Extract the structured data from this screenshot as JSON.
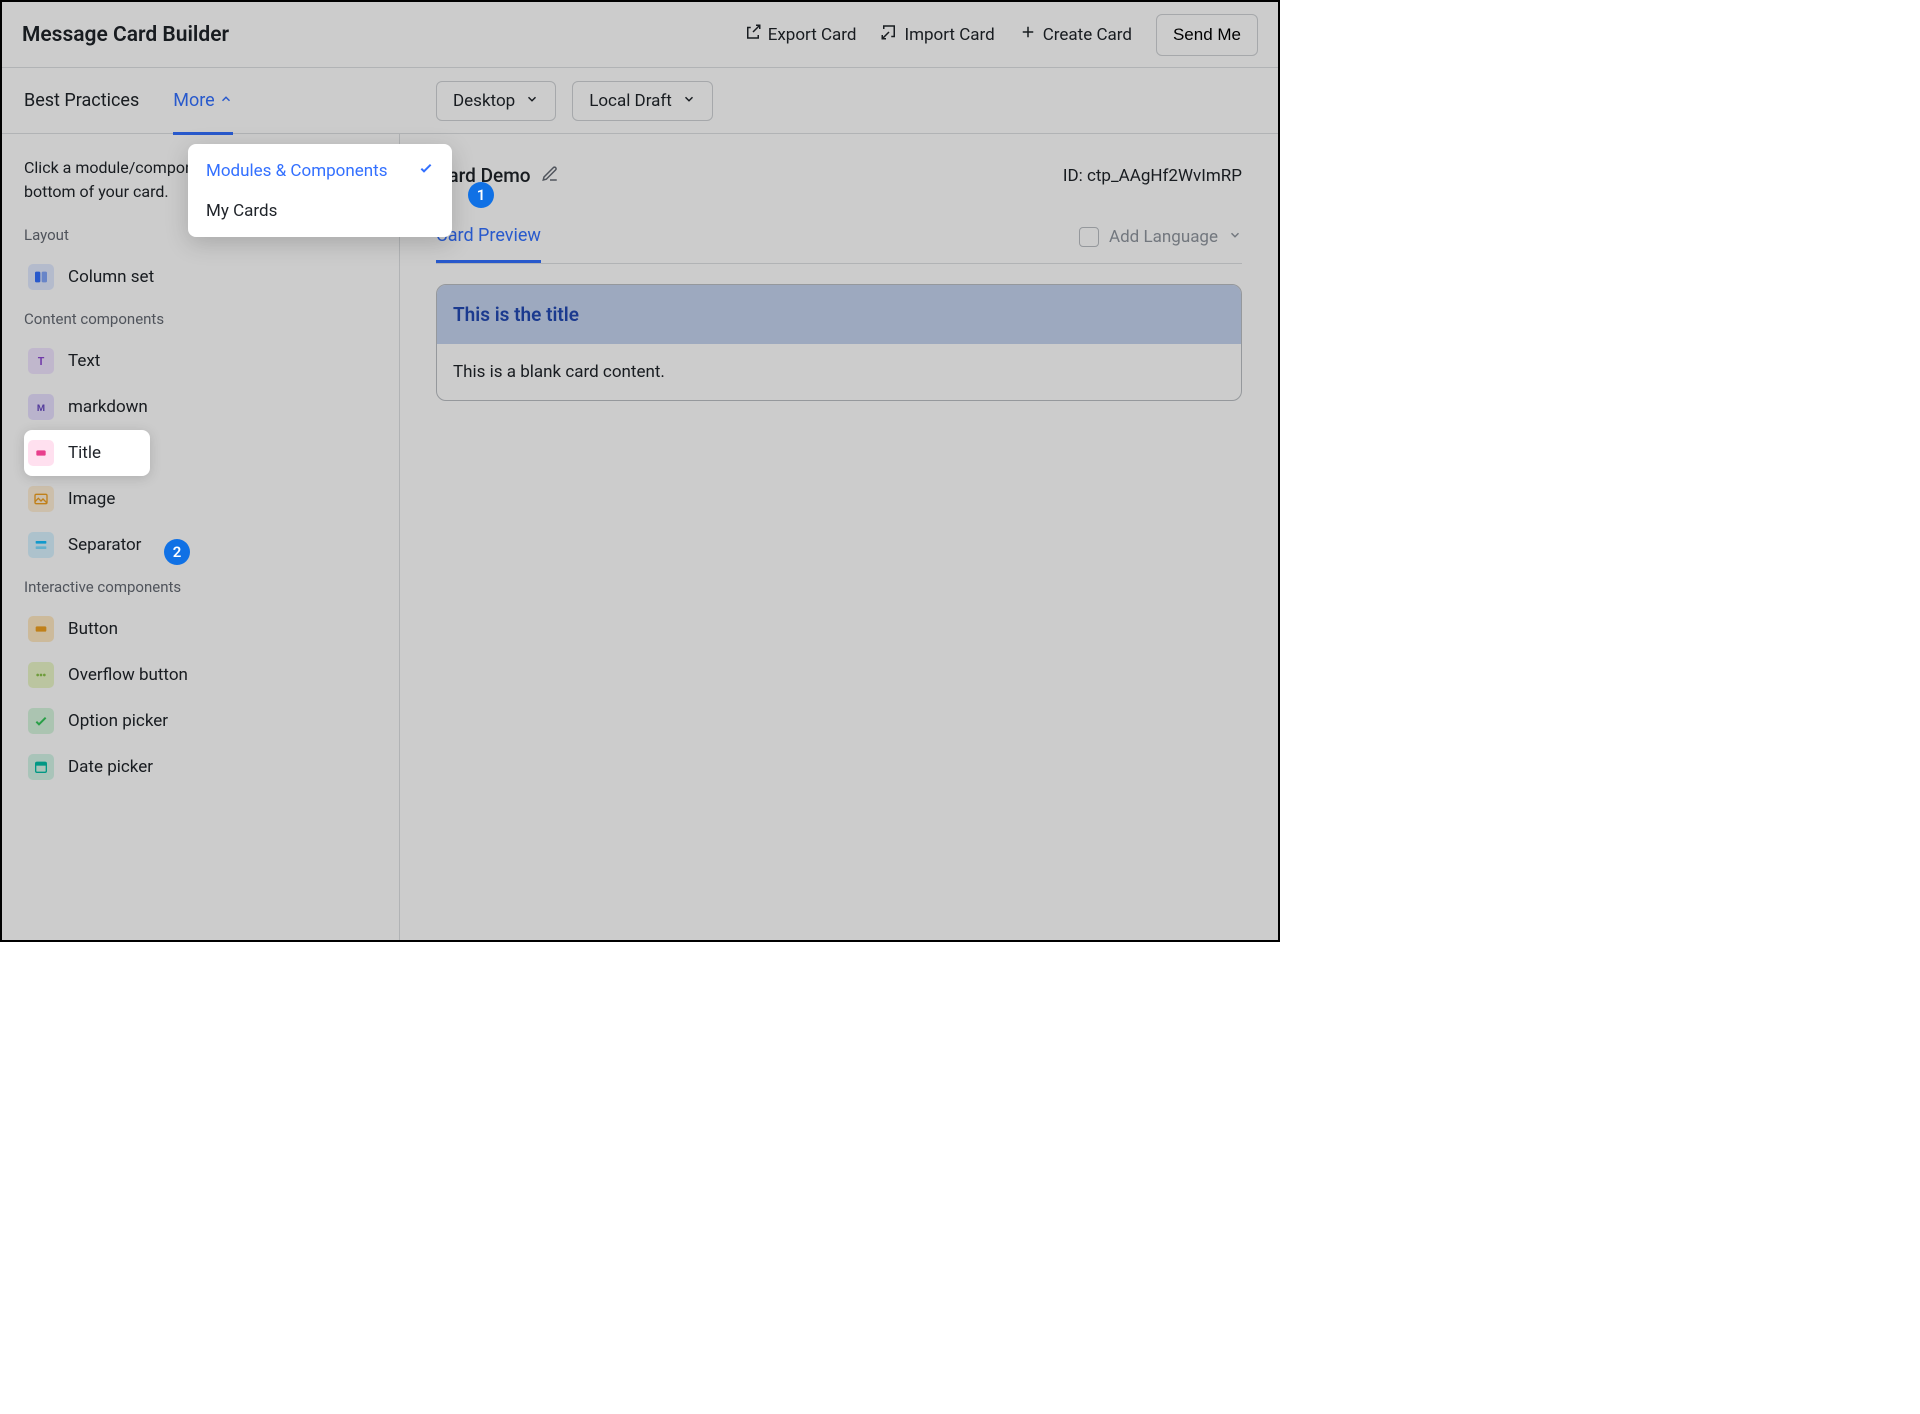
{
  "header": {
    "title": "Message Card Builder",
    "export_label": "Export Card",
    "import_label": "Import Card",
    "create_label": "Create Card",
    "send_label": "Send Me"
  },
  "tabs": {
    "best_practices": "Best Practices",
    "more": "More"
  },
  "preview_controls": {
    "device": "Desktop",
    "draft": "Local Draft"
  },
  "dropdown": {
    "modules": "Modules & Components",
    "my_cards": "My Cards"
  },
  "sidebar": {
    "hint": "Click a module/component to add it to the bottom of your card.",
    "section_layout": "Layout",
    "section_content": "Content components",
    "section_interactive": "Interactive components",
    "items": {
      "column_set": "Column set",
      "text": "Text",
      "markdown": "markdown",
      "title": "Title",
      "image": "Image",
      "separator": "Separator",
      "button": "Button",
      "overflow": "Overflow button",
      "option_picker": "Option picker",
      "date_picker": "Date picker"
    }
  },
  "main": {
    "card_name": "Card Demo",
    "card_id": "ID: ctp_AAgHf2WvImRP",
    "preview_tab": "Card Preview",
    "add_language": "Add Language"
  },
  "card": {
    "title": "This is the title",
    "body": "This is a blank card content."
  },
  "badges": {
    "one": "1",
    "two": "2"
  }
}
